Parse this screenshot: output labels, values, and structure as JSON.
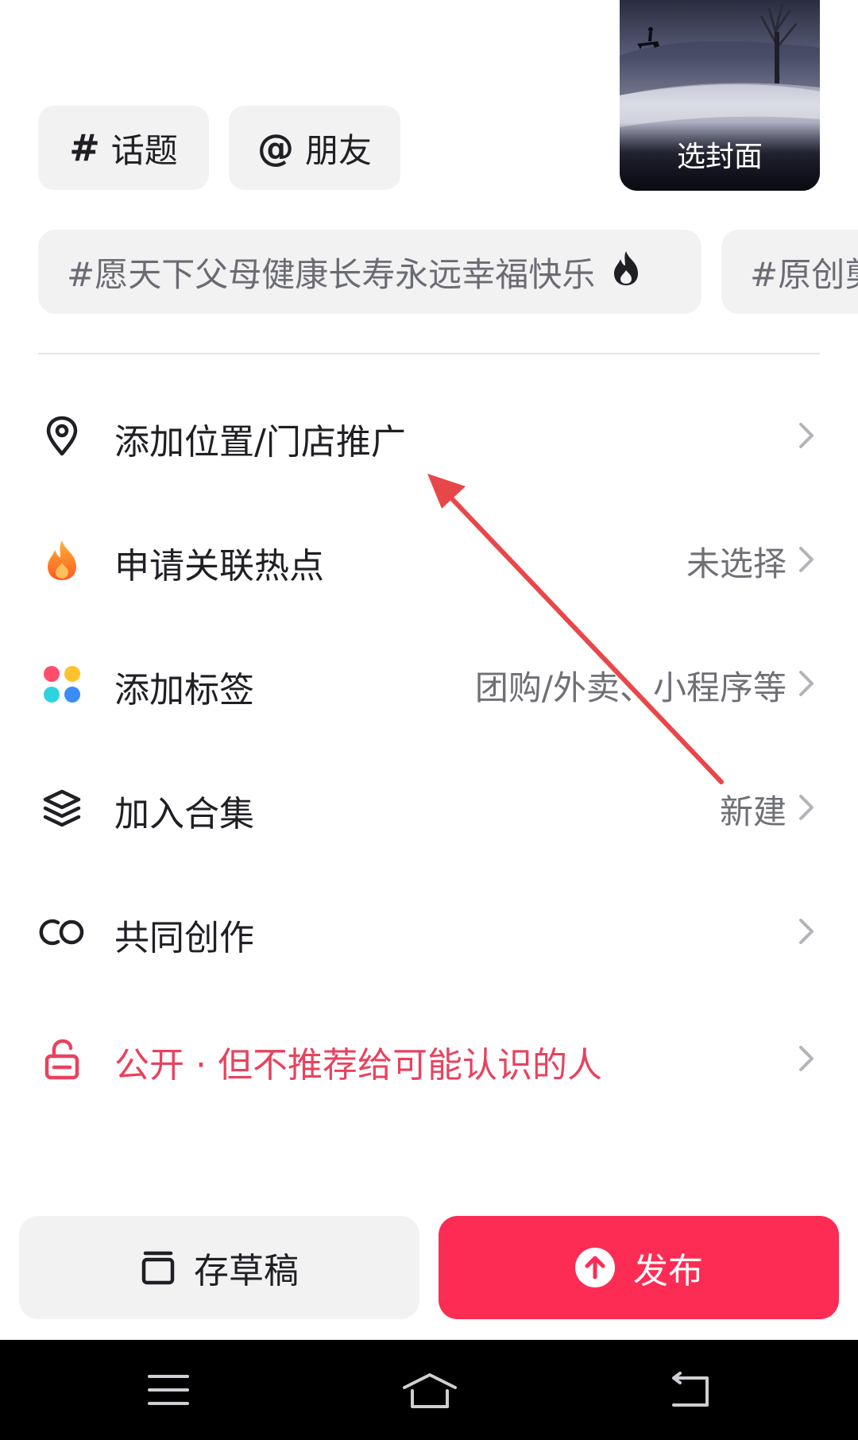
{
  "chips": {
    "topic": {
      "symbol": "#",
      "label": "话题"
    },
    "friend": {
      "symbol": "@",
      "label": "朋友"
    }
  },
  "cover": {
    "label": "选封面"
  },
  "hashtags": [
    {
      "text": "#愿天下父母健康长寿永远幸福快乐",
      "hot": true
    },
    {
      "text": "#原创剪"
    }
  ],
  "settings": [
    {
      "label": "添加位置/门店推广",
      "value": "",
      "icon": "location-pin-icon"
    },
    {
      "label": "申请关联热点",
      "value": "未选择",
      "icon": "flame-icon"
    },
    {
      "label": "添加标签",
      "value": "团购/外卖、小程序等",
      "icon": "color-dots-icon"
    },
    {
      "label": "加入合集",
      "value": "新建",
      "icon": "layers-icon"
    },
    {
      "label": "共同创作",
      "value": "",
      "icon": "co-create-icon"
    },
    {
      "label": "公开 · 但不推荐给可能认识的人",
      "value": "",
      "icon": "unlock-icon"
    }
  ],
  "buttons": {
    "draft": "存草稿",
    "publish": "发布"
  },
  "colors": {
    "accent": "#fd2c55",
    "privacy_red": "#e8425f",
    "chip_bg": "#f2f2f3",
    "annotation_arrow": "#e8474a"
  }
}
